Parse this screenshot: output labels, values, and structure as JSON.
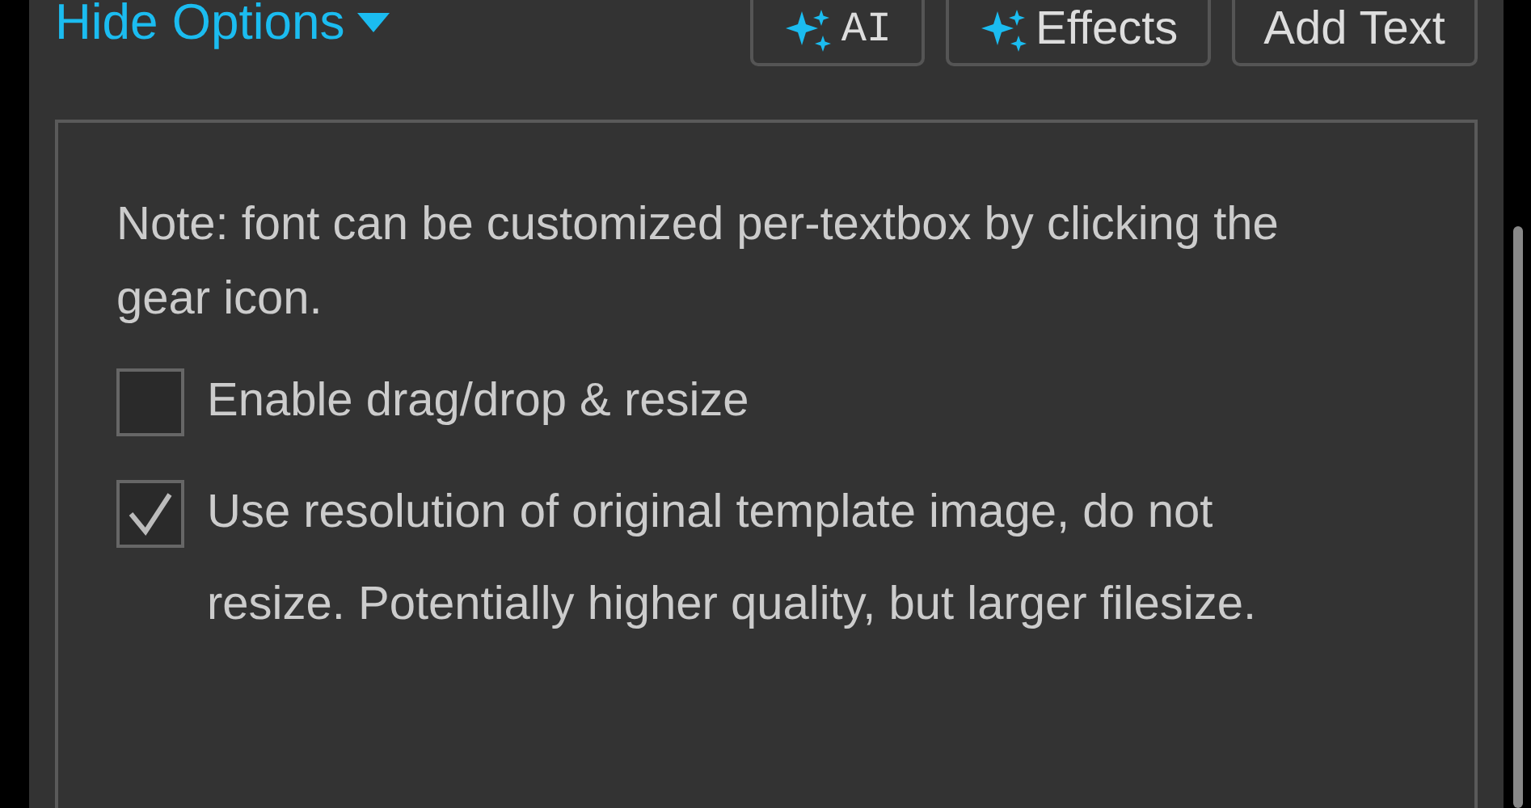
{
  "header": {
    "toggle": {
      "label": "Hide Options",
      "expanded": true
    },
    "buttons": [
      {
        "label": "AI",
        "kind": "ai"
      },
      {
        "label": "Effects",
        "kind": "effects"
      },
      {
        "label": "Add Text",
        "kind": "plain"
      }
    ]
  },
  "options": {
    "note": "Note: font can be customized per-textbox by clicking the gear icon.",
    "checkboxes": [
      {
        "label": "Enable drag/drop & resize",
        "checked": false
      },
      {
        "label": "Use resolution of original template image, do not resize. Potentially higher quality, but larger filesize.",
        "checked": true
      }
    ]
  }
}
